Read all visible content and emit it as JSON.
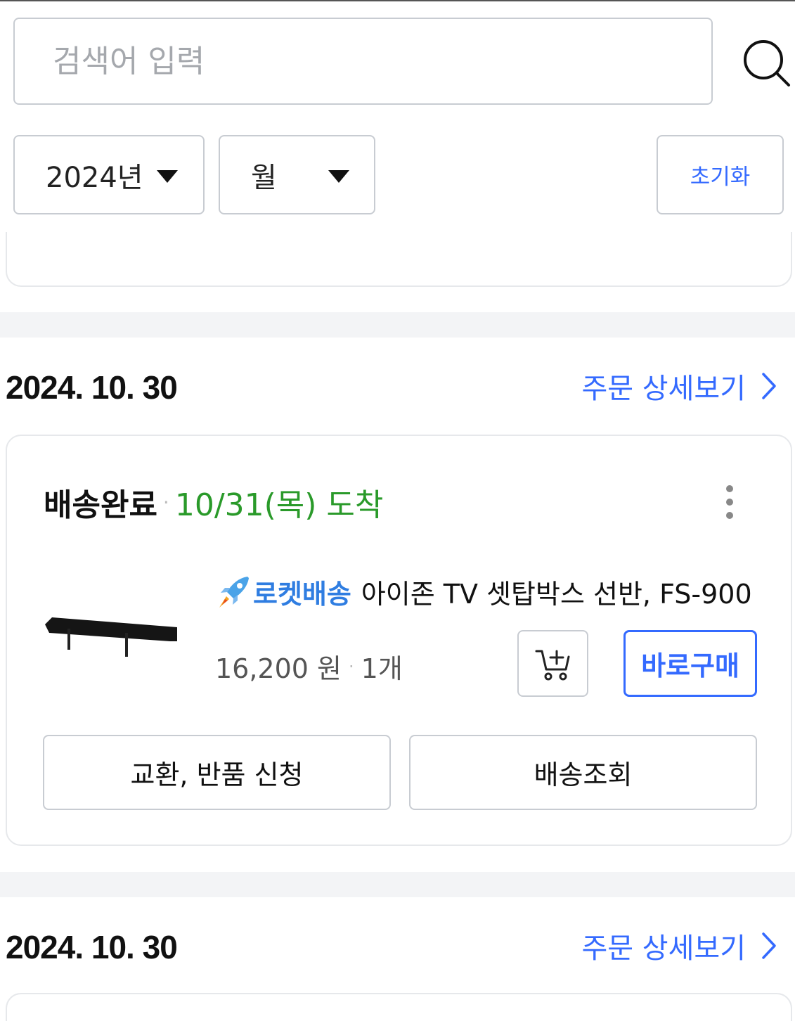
{
  "search": {
    "placeholder": "검색어 입력",
    "value": ""
  },
  "filters": {
    "year": "2024년",
    "month": "월",
    "reset_label": "초기화"
  },
  "orders": [
    {
      "date": "2024. 10. 30",
      "detail_label": "주문 상세보기",
      "status": "배송완료",
      "arrival": "10/31(목) 도착",
      "item": {
        "badge": "로켓배송",
        "name": "아이존 TV 셋탑박스 선반, FS-900",
        "price": "16,200 원",
        "quantity": "1개"
      },
      "buy_now_label": "바로구매",
      "return_label": "교환, 반품 신청",
      "track_label": "배송조회"
    },
    {
      "date": "2024. 10. 30",
      "detail_label": "주문 상세보기"
    }
  ],
  "colors": {
    "accent": "#346aff",
    "rocket": "#2f7de1",
    "arrival": "#2a9a2a",
    "border": "#c8ccd2",
    "section_gap": "#f3f4f6"
  },
  "icons": [
    "search-icon",
    "caret-down-icon",
    "more-vertical-icon",
    "chevron-right-icon",
    "rocket-icon",
    "add-to-cart-icon"
  ]
}
